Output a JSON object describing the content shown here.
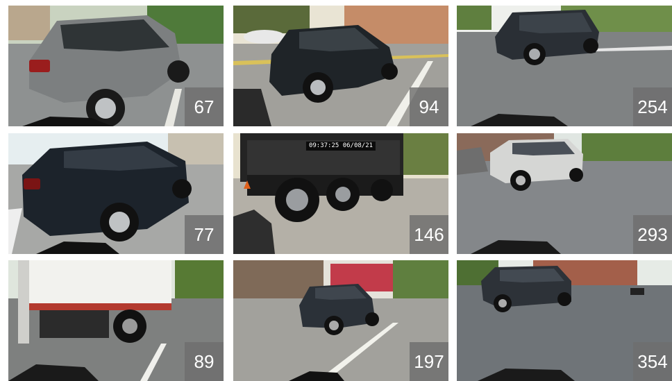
{
  "tiles": [
    {
      "label": "67",
      "timestamp": "",
      "scene": "gray-hatchback"
    },
    {
      "label": "94",
      "timestamp": "",
      "scene": "dark-wagon"
    },
    {
      "label": "254",
      "timestamp": "",
      "scene": "dark-suv-intersection"
    },
    {
      "label": "77",
      "timestamp": "",
      "scene": "dark-sedan-close"
    },
    {
      "label": "146",
      "timestamp": "09:37:25  06/08/21",
      "scene": "dump-truck"
    },
    {
      "label": "293",
      "timestamp": "",
      "scene": "white-suv"
    },
    {
      "label": "89",
      "timestamp": "",
      "scene": "box-truck"
    },
    {
      "label": "197",
      "timestamp": "",
      "scene": "dark-crossover"
    },
    {
      "label": "354",
      "timestamp": "",
      "scene": "dark-suv-street"
    }
  ]
}
